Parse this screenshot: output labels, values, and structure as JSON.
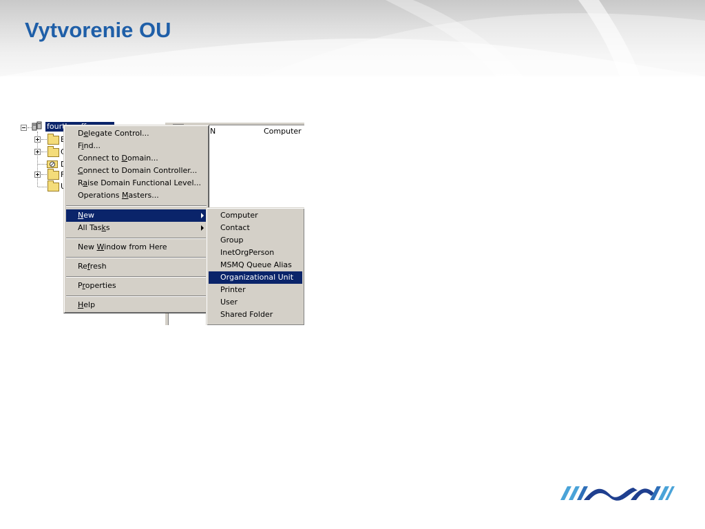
{
  "slide": {
    "title": "Vytvorenie OU"
  },
  "tree": {
    "root_label": "fourth.coffee",
    "child_initials": [
      "B",
      "C",
      "D",
      "F",
      "U"
    ]
  },
  "list_pane": {
    "col1": "N",
    "col2": "Computer"
  },
  "context_menu": {
    "items": [
      {
        "before": "D",
        "key": "e",
        "after": "legate Control..."
      },
      {
        "before": "F",
        "key": "i",
        "after": "nd..."
      },
      {
        "before": "Connect to ",
        "key": "D",
        "after": "omain..."
      },
      {
        "before": "",
        "key": "C",
        "after": "onnect to Domain Controller..."
      },
      {
        "before": "R",
        "key": "a",
        "after": "ise Domain Functional Level..."
      },
      {
        "before": "Operations ",
        "key": "M",
        "after": "asters..."
      },
      {
        "before": "",
        "key": "N",
        "after": "ew",
        "submenu": true,
        "selected": true
      },
      {
        "before": "All Tas",
        "key": "k",
        "after": "s",
        "submenu": true
      },
      {
        "before": "New ",
        "key": "W",
        "after": "indow from Here"
      },
      {
        "before": "Re",
        "key": "f",
        "after": "resh"
      },
      {
        "before": "P",
        "key": "r",
        "after": "operties"
      },
      {
        "before": "",
        "key": "H",
        "after": "elp"
      }
    ]
  },
  "new_submenu": {
    "items": [
      "Computer",
      "Contact",
      "Group",
      "InetOrgPerson",
      "MSMQ Queue Alias",
      "Organizational Unit",
      "Printer",
      "User",
      "Shared Folder"
    ],
    "selected_index": 5
  },
  "colors": {
    "title": "#1f5fa8",
    "menu_bg": "#d4d0c8",
    "selection": "#0a246a",
    "logo_dark": "#1f3f8f",
    "logo_light": "#4aa3d8"
  }
}
